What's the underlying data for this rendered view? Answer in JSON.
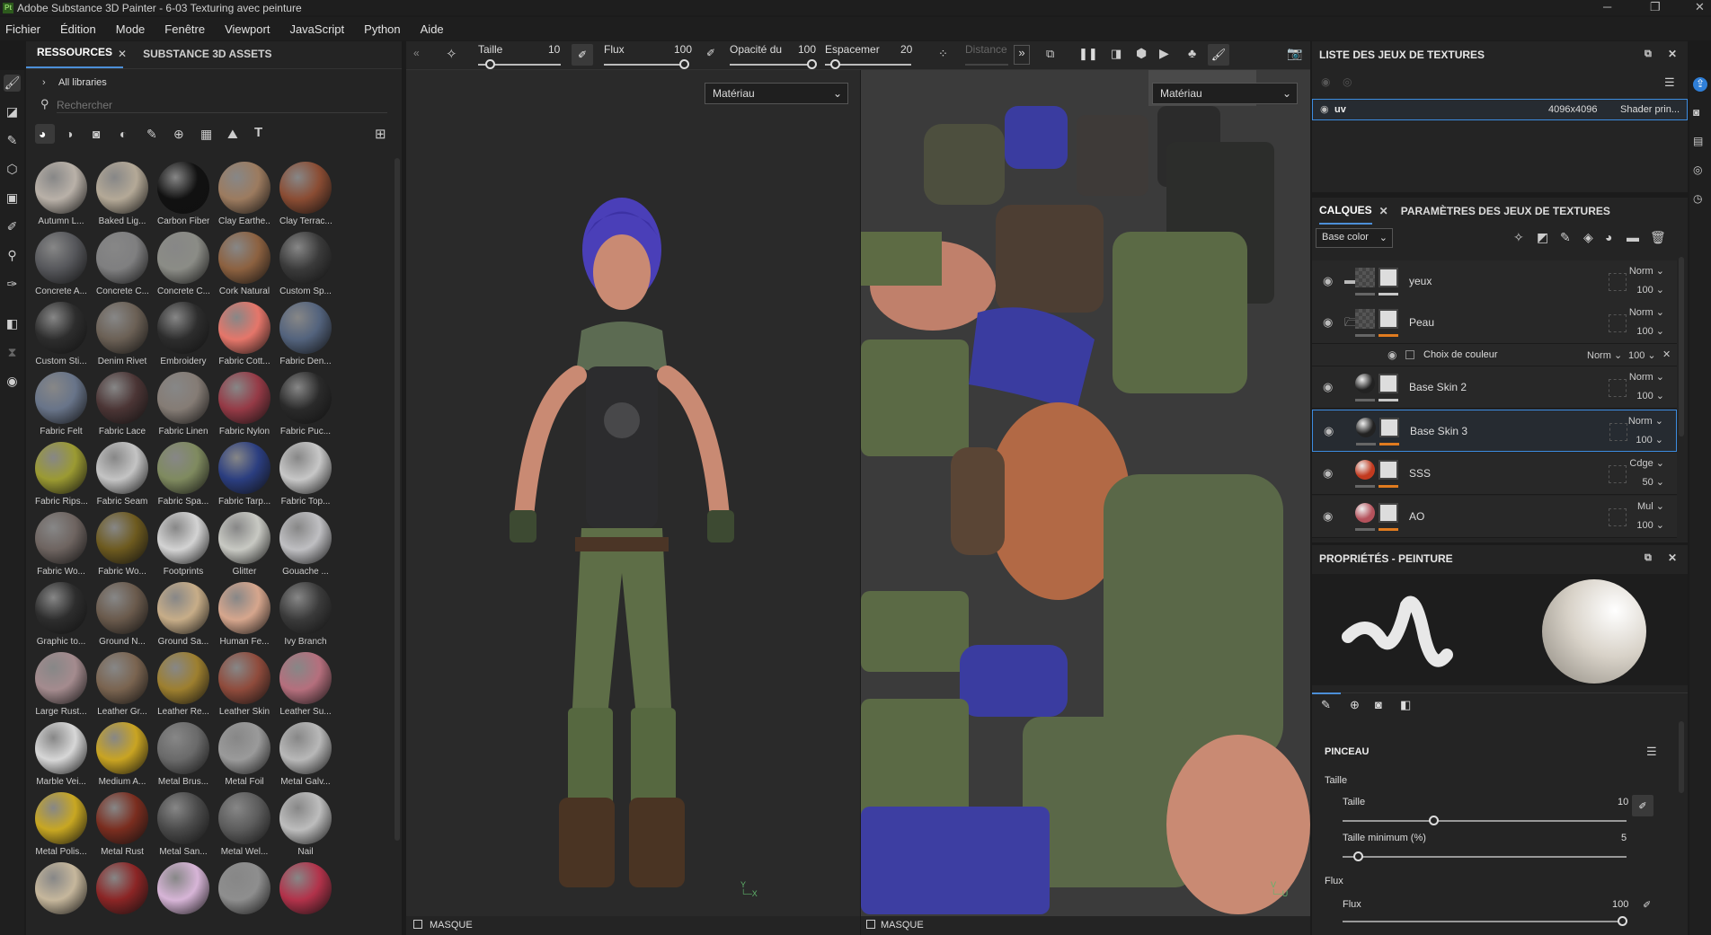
{
  "window": {
    "title": "Adobe Substance 3D Painter - 6-03 Texturing avec peinture",
    "logo": "Pt"
  },
  "menu": [
    "Fichier",
    "Édition",
    "Mode",
    "Fenêtre",
    "Viewport",
    "JavaScript",
    "Python",
    "Aide"
  ],
  "assets": {
    "tabs": [
      "RESSOURCES",
      "SUBSTANCE 3D ASSETS"
    ],
    "library": "All libraries",
    "search_placeholder": "Rechercher",
    "items": [
      {
        "label": "Autumn L...",
        "color": "#b9b1a8"
      },
      {
        "label": "Baked Lig...",
        "color": "#b4a997"
      },
      {
        "label": "Carbon Fiber",
        "color": "#111111"
      },
      {
        "label": "Clay Earthe...",
        "color": "#9c7b5f"
      },
      {
        "label": "Clay Terrac...",
        "color": "#8a4c33"
      },
      {
        "label": "Concrete A...",
        "color": "#56575b"
      },
      {
        "label": "Concrete C...",
        "color": "#7f7f80"
      },
      {
        "label": "Concrete C...",
        "color": "#8b8c86"
      },
      {
        "label": "Cork Natural",
        "color": "#8c6140"
      },
      {
        "label": "Custom Sp...",
        "color": "#3a3a3a"
      },
      {
        "label": "Custom Sti...",
        "color": "#2d2d2d"
      },
      {
        "label": "Denim Rivet",
        "color": "#6b6055"
      },
      {
        "label": "Embroidery",
        "color": "#2d2d2d"
      },
      {
        "label": "Fabric Cott...",
        "color": "#e5766a"
      },
      {
        "label": "Fabric Den...",
        "color": "#53637d"
      },
      {
        "label": "Fabric Felt",
        "color": "#687489"
      },
      {
        "label": "Fabric Lace",
        "color": "#4b3535"
      },
      {
        "label": "Fabric Linen",
        "color": "#857c75"
      },
      {
        "label": "Fabric Nylon",
        "color": "#953a46"
      },
      {
        "label": "Fabric Puc...",
        "color": "#2a2a2a"
      },
      {
        "label": "Fabric Rips...",
        "color": "#9b9a32"
      },
      {
        "label": "Fabric Seam",
        "color": "#c4c4c4"
      },
      {
        "label": "Fabric Spa...",
        "color": "#7f8a5f"
      },
      {
        "label": "Fabric Tarp...",
        "color": "#2b3e80"
      },
      {
        "label": "Fabric Top...",
        "color": "#c7c7c7"
      },
      {
        "label": "Fabric Wo...",
        "color": "#6e6460"
      },
      {
        "label": "Fabric Wo...",
        "color": "#6d5a1f"
      },
      {
        "label": "Footprints",
        "color": "#d3d3d3"
      },
      {
        "label": "Glitter",
        "color": "#c8c9c3"
      },
      {
        "label": "Gouache ...",
        "color": "#bfbfc2"
      },
      {
        "label": "Graphic to...",
        "color": "#2d2d2d"
      },
      {
        "label": "Ground N...",
        "color": "#6a5a4c"
      },
      {
        "label": "Ground Sa...",
        "color": "#c7ad88"
      },
      {
        "label": "Human Fe...",
        "color": "#d6a68d"
      },
      {
        "label": "Ivy Branch",
        "color": "#3a3a3a"
      },
      {
        "label": "Large Rust...",
        "color": "#a48b8e"
      },
      {
        "label": "Leather Gr...",
        "color": "#7a6450"
      },
      {
        "label": "Leather Re...",
        "color": "#9d7f2f"
      },
      {
        "label": "Leather Skin",
        "color": "#8f4b3c"
      },
      {
        "label": "Leather Su...",
        "color": "#b56f7d"
      },
      {
        "label": "Marble Vei...",
        "color": "#d7d7d7"
      },
      {
        "label": "Medium A...",
        "color": "#c9a422"
      },
      {
        "label": "Metal Brus...",
        "color": "#6a6a6a"
      },
      {
        "label": "Metal Foil",
        "color": "#9a9a9a"
      },
      {
        "label": "Metal Galv...",
        "color": "#b8b8b8"
      },
      {
        "label": "Metal Polis...",
        "color": "#c8a722"
      },
      {
        "label": "Metal Rust",
        "color": "#7a2d1f"
      },
      {
        "label": "Metal San...",
        "color": "#4a4a4a"
      },
      {
        "label": "Metal Wel...",
        "color": "#5c5c5c"
      },
      {
        "label": "Nail",
        "color": "#bdbdbd"
      },
      {
        "label": "",
        "color": "#c6b79c"
      },
      {
        "label": "",
        "color": "#8b2525"
      },
      {
        "label": "",
        "color": "#d7b5d7"
      },
      {
        "label": "",
        "color": "#8e8e8e"
      },
      {
        "label": "",
        "color": "#b2324a"
      }
    ]
  },
  "toolbar": {
    "size_label": "Taille",
    "size_value": "10",
    "flow_label": "Flux",
    "flow_value": "100",
    "opacity_label": "Opacité du",
    "opacity_value": "100",
    "spacing_label": "Espacemer",
    "spacing_value": "20",
    "distance_label": "Distance"
  },
  "viewport3d": {
    "dropdown": "Matériau",
    "mask_label": "MASQUE"
  },
  "viewport2d": {
    "dropdown": "Matériau",
    "mask_label": "MASQUE"
  },
  "texture_sets": {
    "title": "LISTE DES JEUX DE TEXTURES",
    "row": {
      "name": "uv",
      "resolution": "4096x4096",
      "shader": "Shader prin..."
    }
  },
  "layers": {
    "tabs": [
      "CALQUES",
      "PARAMÈTRES DES JEUX DE TEXTURES"
    ],
    "channel": "Base color",
    "items": [
      {
        "name": "yeux",
        "blend": "Norm",
        "opacity": "100",
        "folder": true,
        "accent": "#c8c8c8"
      },
      {
        "name": "Peau",
        "blend": "Norm",
        "opacity": "100",
        "folder": true,
        "accent": "#e07b1f"
      },
      {
        "name": "Base Skin 2",
        "blend": "Norm",
        "opacity": "100",
        "folder": false,
        "accent": "#c8c8c8"
      },
      {
        "name": "Base Skin 3",
        "blend": "Norm",
        "opacity": "100",
        "folder": false,
        "accent": "#e07b1f"
      },
      {
        "name": "SSS",
        "blend": "Cdge",
        "opacity": "50",
        "folder": false,
        "accent": "#e07b1f"
      },
      {
        "name": "AO",
        "blend": "Mul",
        "opacity": "100",
        "folder": false,
        "accent": "#e07b1f"
      }
    ],
    "effect": {
      "name": "Choix de couleur",
      "blend": "Norm",
      "opacity": "100"
    }
  },
  "properties": {
    "title": "PROPRIÉTÉS - PEINTURE",
    "section": "PINCEAU",
    "size_group": "Taille",
    "size_label": "Taille",
    "size_value": "10",
    "min_size_label": "Taille minimum (%)",
    "min_size_value": "5",
    "flow_group": "Flux",
    "flow_label": "Flux",
    "flow_value": "100"
  }
}
